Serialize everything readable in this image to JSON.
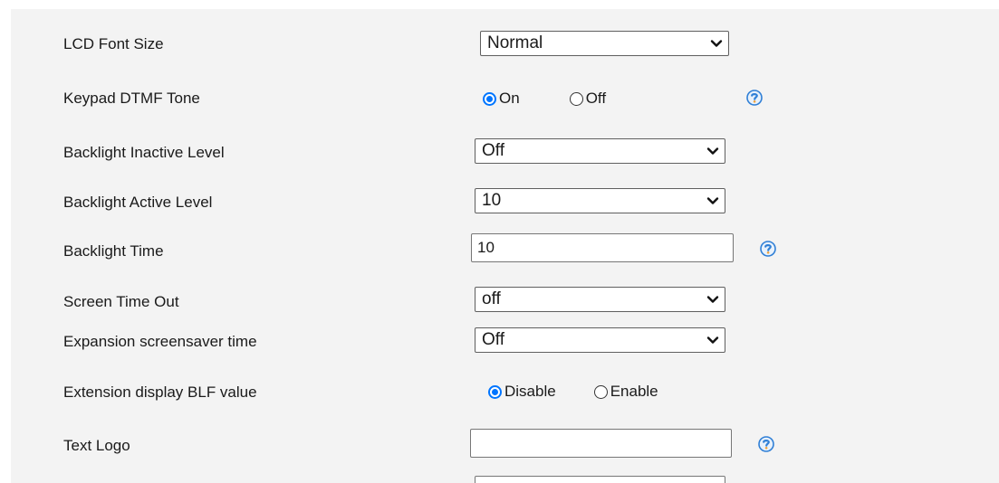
{
  "colors": {
    "panel_bg": "#f3f3f3",
    "radio_accent": "#0075ff",
    "help_icon_blue": "#2f7fd6",
    "help_icon_orange": "#f2a33a"
  },
  "settings": {
    "lcd_font_size": {
      "label": "LCD Font Size",
      "value": "Normal"
    },
    "keypad_dtmf_tone": {
      "label": "Keypad DTMF Tone",
      "options": [
        "On",
        "Off"
      ],
      "selected": "On",
      "help_icon": "question-help-icon"
    },
    "backlight_inactive_level": {
      "label": "Backlight Inactive Level",
      "value": "Off"
    },
    "backlight_active_level": {
      "label": "Backlight Active Level",
      "value": "10"
    },
    "backlight_time": {
      "label": "Backlight Time",
      "value": "10",
      "help_icon": "question-help-icon"
    },
    "screen_time_out": {
      "label": "Screen Time Out",
      "value": "off"
    },
    "expansion_screensaver_time": {
      "label": "Expansion screensaver time",
      "value": "Off"
    },
    "extension_display_blf_value": {
      "label": "Extension display BLF value",
      "options": [
        "Disable",
        "Enable"
      ],
      "selected": "Disable"
    },
    "text_logo": {
      "label": "Text Logo",
      "value": "",
      "help_icon": "question-help-icon"
    }
  }
}
